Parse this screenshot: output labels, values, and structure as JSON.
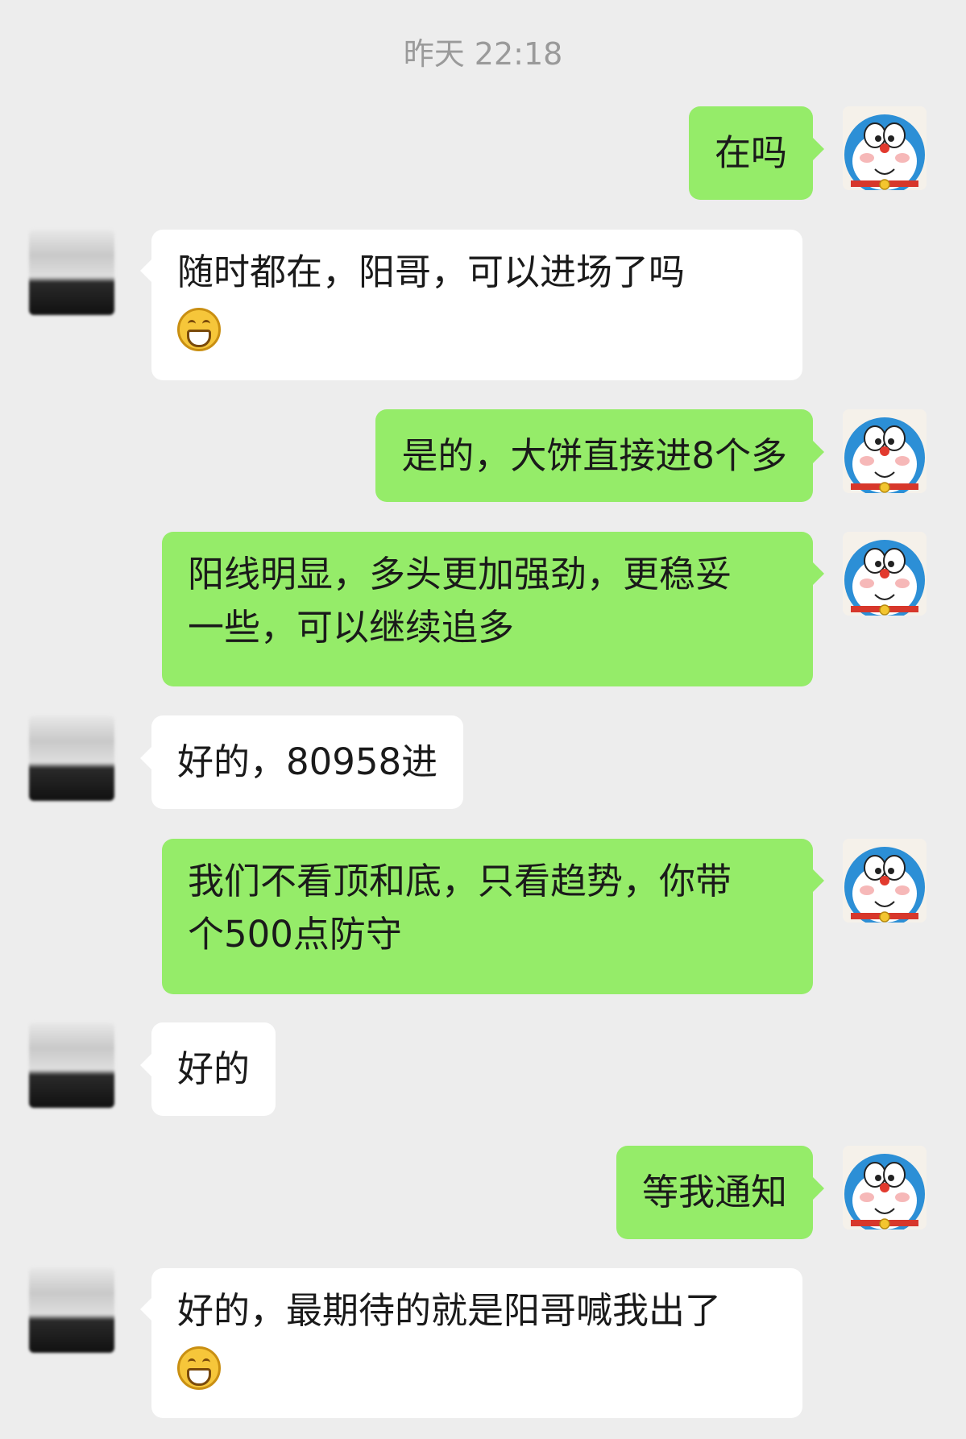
{
  "timestamp": "昨天 22:18",
  "messages": [
    {
      "from": "me",
      "text": "在吗"
    },
    {
      "from": "other",
      "text": "随时都在，阳哥，可以进场了吗",
      "emoji": "grin-emoji"
    },
    {
      "from": "me",
      "text": "是的，大饼直接进8个多"
    },
    {
      "from": "me",
      "text": "阳线明显，多头更加强劲，更稳妥",
      "text2": "一些，可以继续追多"
    },
    {
      "from": "other",
      "text": "好的，80958进"
    },
    {
      "from": "me",
      "text": "我们不看顶和底，只看趋势，你带",
      "text2": "个500点防守"
    },
    {
      "from": "other",
      "text": "好的"
    },
    {
      "from": "me",
      "text": "等我通知"
    },
    {
      "from": "other",
      "text": "好的，最期待的就是阳哥喊我出了",
      "emoji": "grin-emoji"
    }
  ],
  "colors": {
    "me_bubble": "#95ec69",
    "other_bubble": "#ffffff",
    "background": "#ededed"
  },
  "icons": {
    "my_avatar": "doraemon-avatar",
    "other_avatar": "blurred-avatar"
  }
}
